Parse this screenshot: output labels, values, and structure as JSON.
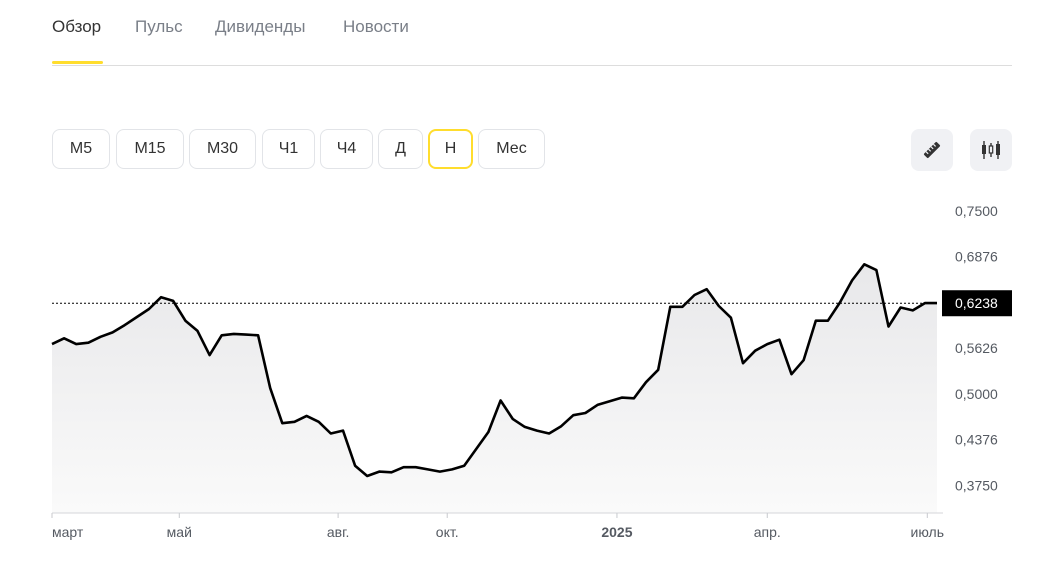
{
  "tabs": [
    {
      "label": "Обзор",
      "active": true
    },
    {
      "label": "Пульс",
      "active": false
    },
    {
      "label": "Дивиденды",
      "active": false
    },
    {
      "label": "Новости",
      "active": false
    }
  ],
  "periods": [
    {
      "label": "M5",
      "active": false
    },
    {
      "label": "M15",
      "active": false
    },
    {
      "label": "M30",
      "active": false
    },
    {
      "label": "Ч1",
      "active": false
    },
    {
      "label": "Ч4",
      "active": false
    },
    {
      "label": "Д",
      "active": false
    },
    {
      "label": "Н",
      "active": true
    },
    {
      "label": "Мес",
      "active": false
    }
  ],
  "tools": [
    {
      "icon": "ruler-icon"
    },
    {
      "icon": "candlestick-icon"
    }
  ],
  "colors": {
    "accent": "#ffdd2d",
    "line": "#000000",
    "price_badge": "#000000"
  },
  "chart_data": {
    "type": "area",
    "ylim": [
      0.3375,
      0.7688
    ],
    "y_ticks": [
      "0,7500",
      "0,6876",
      "0,6250",
      "0,5626",
      "0,5000",
      "0,4376",
      "0,3750"
    ],
    "y_tick_values": [
      0.75,
      0.6876,
      0.625,
      0.5626,
      0.5,
      0.4376,
      0.375
    ],
    "x_labels": [
      {
        "label": "март",
        "week": 0,
        "bold": false
      },
      {
        "label": "май",
        "week": 10.5,
        "bold": false
      },
      {
        "label": "авг.",
        "week": 23.6,
        "bold": false
      },
      {
        "label": "окт.",
        "week": 32.6,
        "bold": false
      },
      {
        "label": "2025",
        "week": 46.6,
        "bold": true
      },
      {
        "label": "апр.",
        "week": 59.0,
        "bold": false
      },
      {
        "label": "июль",
        "week": 72.2,
        "bold": false
      }
    ],
    "last_price": 0.6238,
    "last_price_label": "0,6238",
    "x": [
      0,
      1,
      2,
      3,
      4,
      5,
      6,
      7,
      8,
      9,
      10,
      11,
      12,
      13,
      14,
      15,
      16,
      17,
      18,
      19,
      20,
      21,
      22,
      23,
      24,
      25,
      26,
      27,
      28,
      29,
      30,
      31,
      32,
      33,
      34,
      35,
      36,
      37,
      38,
      39,
      40,
      41,
      42,
      43,
      44,
      45,
      46,
      47,
      48,
      49,
      50,
      51,
      52,
      53,
      54,
      55,
      56,
      57,
      58,
      59,
      60,
      61,
      62,
      63,
      64,
      65,
      66,
      67,
      68,
      69,
      70,
      71,
      72,
      73
    ],
    "values": [
      0.568,
      0.576,
      0.568,
      0.57,
      0.578,
      0.584,
      0.594,
      0.605,
      0.616,
      0.632,
      0.627,
      0.6,
      0.586,
      0.553,
      0.58,
      0.582,
      0.581,
      0.58,
      0.508,
      0.46,
      0.462,
      0.47,
      0.462,
      0.446,
      0.45,
      0.402,
      0.388,
      0.394,
      0.393,
      0.4,
      0.4,
      0.397,
      0.394,
      0.397,
      0.402,
      0.425,
      0.448,
      0.491,
      0.466,
      0.455,
      0.45,
      0.446,
      0.456,
      0.471,
      0.474,
      0.485,
      0.49,
      0.495,
      0.494,
      0.516,
      0.533,
      0.619,
      0.619,
      0.635,
      0.643,
      0.62,
      0.604,
      0.542,
      0.559,
      0.568,
      0.574,
      0.527,
      0.546,
      0.6,
      0.6,
      0.625,
      0.655,
      0.677,
      0.669,
      0.592,
      0.618,
      0.614,
      0.624,
      0.624
    ]
  }
}
